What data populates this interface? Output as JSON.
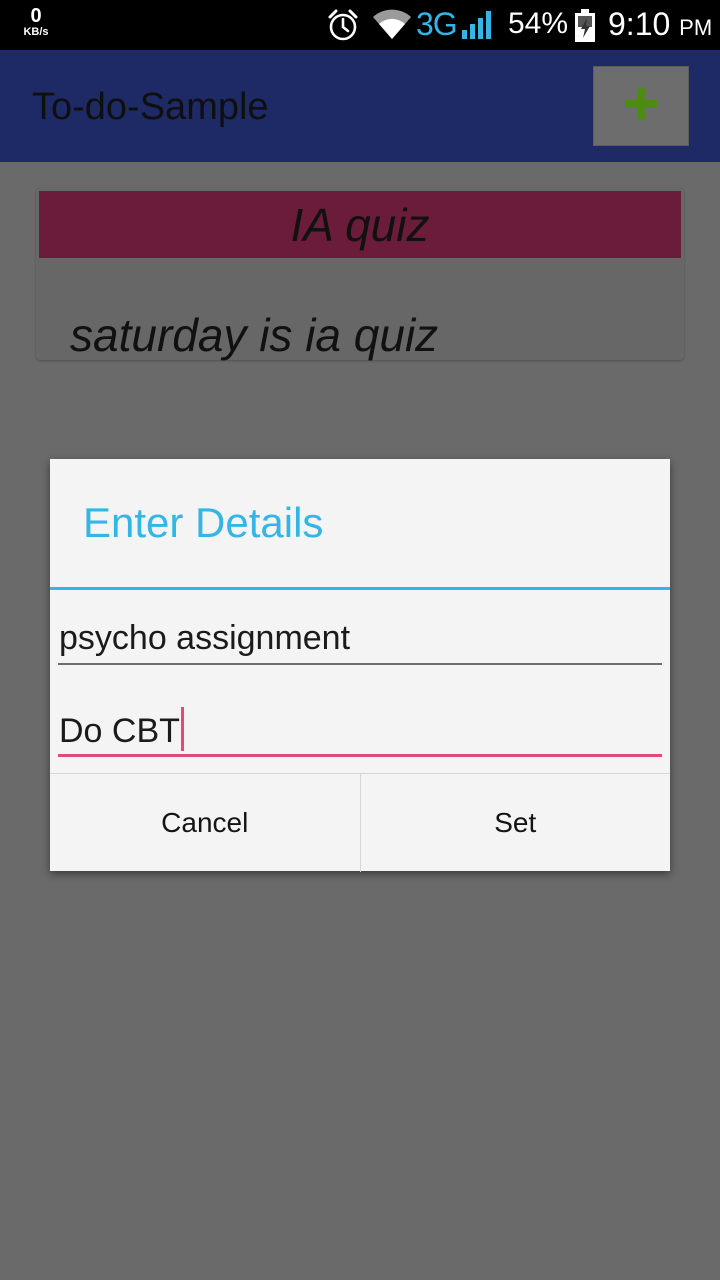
{
  "status_bar": {
    "net_speed_value": "0",
    "net_speed_unit": "KB/s",
    "network_type": "3G",
    "battery_percent": "54%",
    "time": "9:10",
    "time_suffix": "PM",
    "icons": [
      "alarm-icon",
      "wifi-icon",
      "signal-icon",
      "battery-charging-icon"
    ]
  },
  "app_bar": {
    "title": "To-do-Sample",
    "add_icon": "plus-icon",
    "add_icon_color": "#4e8b12"
  },
  "note": {
    "title": "IA quiz",
    "body": "saturday is ia quiz",
    "title_bar_color": "#6b1c3a"
  },
  "dialog": {
    "title": "Enter Details",
    "accent_color": "#33b5e5",
    "fields": [
      {
        "value": "psycho assignment",
        "focused": false
      },
      {
        "value": "Do CBT",
        "focused": true
      }
    ],
    "cancel_label": "Cancel",
    "set_label": "Set"
  },
  "colors": {
    "scrim": "#6a6a6a",
    "focus_underline": "#e2497c"
  }
}
